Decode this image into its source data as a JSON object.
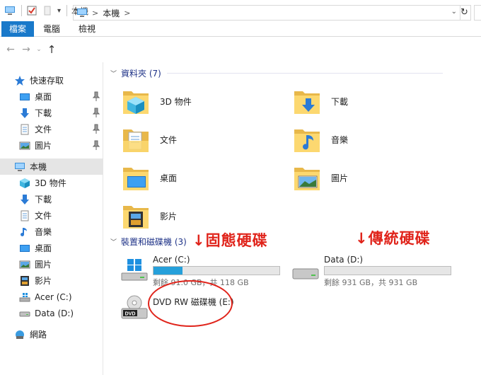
{
  "window": {
    "title": "本機"
  },
  "ribbon": {
    "tabs": [
      "檔案",
      "電腦",
      "檢視"
    ]
  },
  "address": {
    "path": "本機"
  },
  "sidebar": {
    "items": [
      {
        "label": "快速存取",
        "icon": "star-icon"
      },
      {
        "label": "桌面",
        "icon": "desktop-icon"
      },
      {
        "label": "下載",
        "icon": "download-icon"
      },
      {
        "label": "文件",
        "icon": "document-icon"
      },
      {
        "label": "圖片",
        "icon": "picture-icon"
      },
      {
        "label": "本機",
        "icon": "computer-icon"
      },
      {
        "label": "3D 物件",
        "icon": "cube-icon"
      },
      {
        "label": "下載",
        "icon": "download-icon"
      },
      {
        "label": "文件",
        "icon": "document-icon"
      },
      {
        "label": "音樂",
        "icon": "music-icon"
      },
      {
        "label": "桌面",
        "icon": "desktop-icon"
      },
      {
        "label": "圖片",
        "icon": "picture-icon"
      },
      {
        "label": "影片",
        "icon": "film-icon"
      },
      {
        "label": "Acer (C:)",
        "icon": "windows-drive-icon"
      },
      {
        "label": "Data (D:)",
        "icon": "drive-icon"
      },
      {
        "label": "網路",
        "icon": "network-icon"
      }
    ]
  },
  "folders_group": {
    "header": "資料夾 (7)",
    "items": [
      {
        "label": "3D 物件",
        "icon": "cube-folder-icon"
      },
      {
        "label": "下載",
        "icon": "download-folder-icon"
      },
      {
        "label": "文件",
        "icon": "document-folder-icon"
      },
      {
        "label": "音樂",
        "icon": "music-folder-icon"
      },
      {
        "label": "桌面",
        "icon": "desktop-folder-icon"
      },
      {
        "label": "圖片",
        "icon": "picture-folder-icon"
      },
      {
        "label": "影片",
        "icon": "film-folder-icon"
      }
    ]
  },
  "drives_group": {
    "header": "裝置和磁碟機 (3)",
    "drives": [
      {
        "name": "Acer (C:)",
        "info": "剩餘 91.0 GB，共 118 GB",
        "used_fraction": 0.23,
        "icon": "windows-drive-icon"
      },
      {
        "name": "Data (D:)",
        "info": "剩餘 931 GB，共 931 GB",
        "used_fraction": 0.0,
        "icon": "drive-icon"
      },
      {
        "name": "DVD RW 磁碟機 (E:)",
        "icon": "dvd-drive-icon"
      }
    ]
  },
  "annotations": {
    "ssd": "↓固態硬碟",
    "hdd": "↓傳統硬碟"
  },
  "colors": {
    "accent": "#1979ca",
    "annotation": "#e0241b",
    "header": "#1e3287",
    "bar_fill": "#26a0da"
  }
}
